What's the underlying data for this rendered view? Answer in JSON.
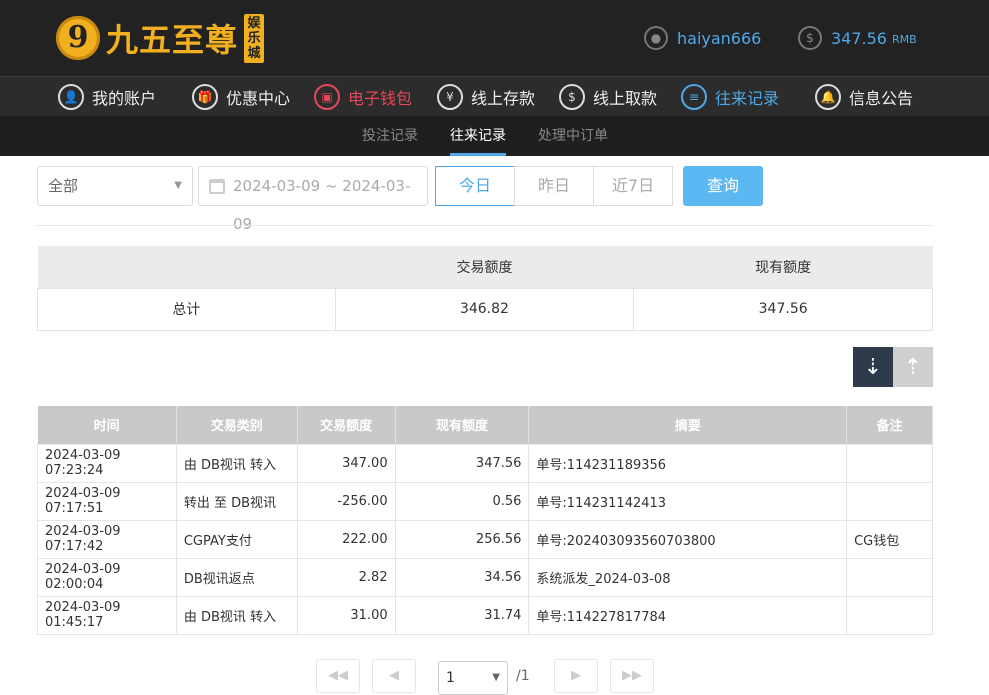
{
  "header": {
    "brand": "九五至尊",
    "brand_mark": "9",
    "brand_sub": "娱乐城",
    "username": "haiyan666",
    "balance": "347.56",
    "balance_unit": "RMB"
  },
  "nav": [
    {
      "label": "我的账户",
      "icon": "user-icon",
      "glyph": "👤"
    },
    {
      "label": "优惠中心",
      "icon": "gift-icon",
      "glyph": "🎁"
    },
    {
      "label": "电子钱包",
      "icon": "wallet-icon",
      "glyph": "▣"
    },
    {
      "label": "线上存款",
      "icon": "deposit-icon",
      "glyph": "¥"
    },
    {
      "label": "线上取款",
      "icon": "withdraw-icon",
      "glyph": "$"
    },
    {
      "label": "往来记录",
      "icon": "record-icon",
      "glyph": "≡"
    },
    {
      "label": "信息公告",
      "icon": "bell-icon",
      "glyph": "🔔"
    }
  ],
  "subnav": [
    "投注记录",
    "往来记录",
    "处理中订单"
  ],
  "filter": {
    "type_selected": "全部",
    "date_range": "2024-03-09 ~ 2024-03-09",
    "quick": [
      "今日",
      "昨日",
      "近7日"
    ],
    "query_label": "查询"
  },
  "summary": {
    "headers": [
      "",
      "交易额度",
      "现有额度"
    ],
    "row": [
      "总计",
      "346.82",
      "347.56"
    ]
  },
  "records": {
    "headers": [
      "时间",
      "交易类别",
      "交易额度",
      "现有额度",
      "摘要",
      "备注"
    ],
    "rows": [
      [
        "2024-03-09 07:23:24",
        "由 DB视讯 转入",
        "347.00",
        "347.56",
        "单号:114231189356",
        ""
      ],
      [
        "2024-03-09 07:17:51",
        "转出 至 DB视讯",
        "-256.00",
        "0.56",
        "单号:114231142413",
        ""
      ],
      [
        "2024-03-09 07:17:42",
        "CGPAY支付",
        "222.00",
        "256.56",
        "单号:202403093560703800",
        "CG钱包"
      ],
      [
        "2024-03-09 02:00:04",
        "DB视讯返点",
        "2.82",
        "34.56",
        "系统派发_2024-03-08",
        ""
      ],
      [
        "2024-03-09 01:45:17",
        "由 DB视讯 转入",
        "31.00",
        "31.74",
        "单号:114227817784",
        ""
      ]
    ]
  },
  "pagination": {
    "page": "1",
    "total": "/1"
  }
}
